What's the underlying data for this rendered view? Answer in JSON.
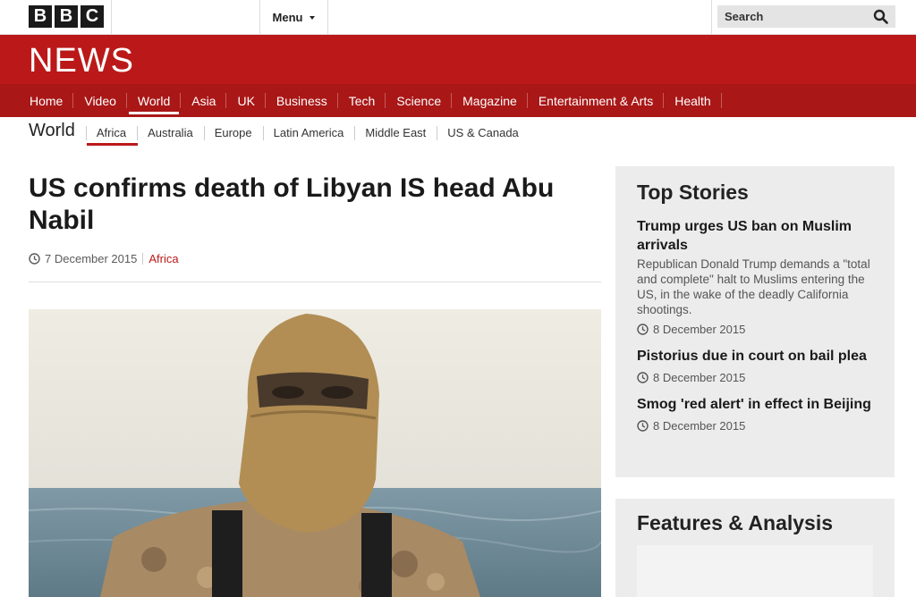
{
  "masthead": {
    "logo_letters": [
      "B",
      "B",
      "C"
    ],
    "menu_label": "Menu",
    "search_placeholder": "Search"
  },
  "brand": {
    "news_title": "NEWS",
    "accent": "#bb1919"
  },
  "primary_nav": {
    "items": [
      "Home",
      "Video",
      "World",
      "Asia",
      "UK",
      "Business",
      "Tech",
      "Science",
      "Magazine",
      "Entertainment & Arts",
      "Health"
    ],
    "active": "World"
  },
  "secondary_nav": {
    "title": "World",
    "items": [
      "Africa",
      "Australia",
      "Europe",
      "Latin America",
      "Middle East",
      "US & Canada"
    ],
    "active": "Africa"
  },
  "article": {
    "headline": "US confirms death of Libyan IS head Abu Nabil",
    "date": "7 December 2015",
    "section": "Africa"
  },
  "top_stories": {
    "heading": "Top Stories",
    "stories": [
      {
        "title": "Trump urges US ban on Muslim arrivals",
        "summary": "Republican Donald Trump demands a \"total and complete\" halt to Muslims entering the US, in the wake of the deadly California shootings.",
        "date": "8 December 2015"
      },
      {
        "title": "Pistorius due in court on bail plea",
        "summary": "",
        "date": "8 December 2015"
      },
      {
        "title": "Smog 'red alert' in effect in Beijing",
        "summary": "",
        "date": "8 December 2015"
      }
    ]
  },
  "features": {
    "heading": "Features & Analysis"
  }
}
